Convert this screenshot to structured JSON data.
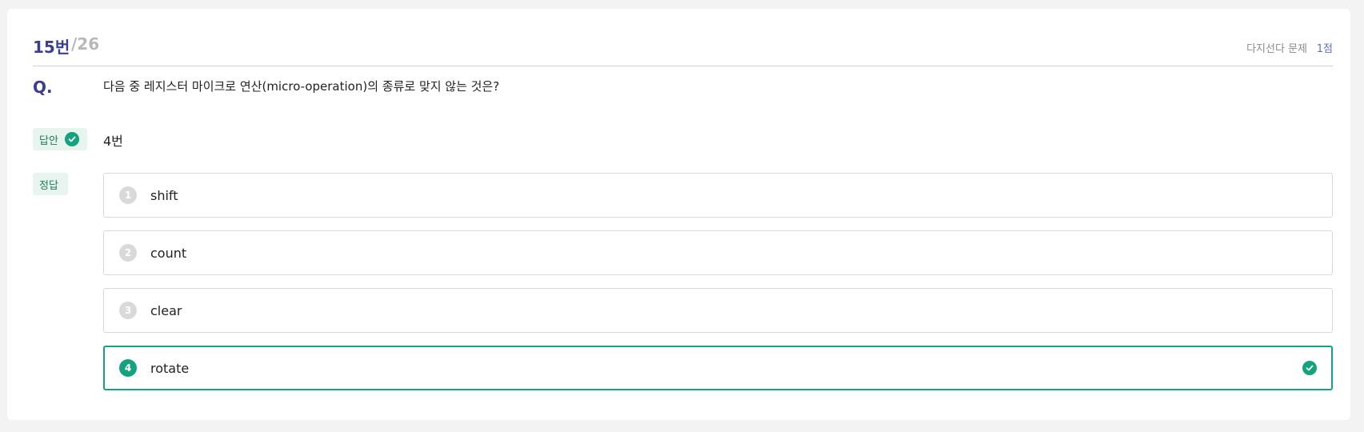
{
  "header": {
    "question_number": "15번",
    "question_total": "/26",
    "question_type": "다지선다 문제",
    "score": "1점"
  },
  "question": {
    "marker": "Q.",
    "text": "다음 중 레지스터 마이크로 연산(micro-operation)의 종류로 맞지 않는 것은?"
  },
  "answer": {
    "label": "답안",
    "value": "4번",
    "icon": "check-circle-icon"
  },
  "correct": {
    "label": "정답"
  },
  "options": [
    {
      "number": "1",
      "label": "shift",
      "selected": false
    },
    {
      "number": "2",
      "label": "count",
      "selected": false
    },
    {
      "number": "3",
      "label": "clear",
      "selected": false
    },
    {
      "number": "4",
      "label": "rotate",
      "selected": true
    }
  ],
  "colors": {
    "accent_green": "#14a37f",
    "title_blue": "#3b3f8f",
    "score_blue": "#5a6bd4"
  }
}
